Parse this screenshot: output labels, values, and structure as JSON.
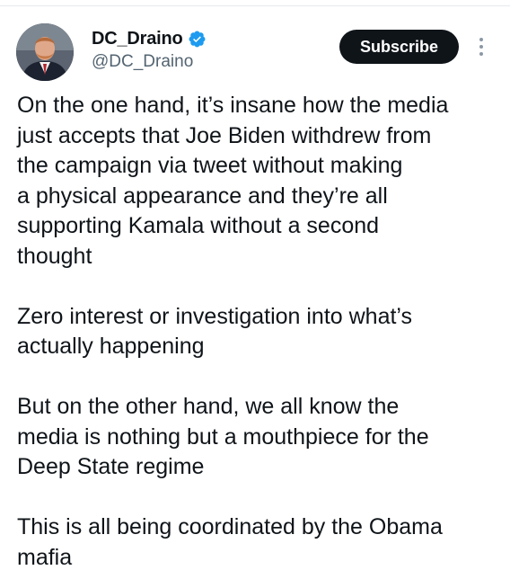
{
  "author": {
    "display_name": "DC_Draino",
    "handle": "@DC_Draino",
    "verified": true,
    "avatar_icon": "profile-photo"
  },
  "actions": {
    "subscribe_label": "Subscribe",
    "more_icon": "vertical-ellipsis-icon"
  },
  "tweet": {
    "paragraphs": [
      "On the one hand, it’s insane how the media\njust accepts that Joe Biden withdrew from\nthe campaign via tweet without making\na physical appearance and they’re all\nsupporting Kamala without a second\nthought",
      "Zero interest or investigation into what’s\nactually happening",
      "But on the other hand, we all know the\nmedia is nothing but a mouthpiece for the\nDeep State regime",
      "This is all being coordinated by the Obama\nmafia"
    ]
  },
  "colors": {
    "text_primary": "#0f1419",
    "text_secondary": "#536471",
    "verified_blue": "#1d9bf0",
    "button_bg": "#0f1419"
  }
}
